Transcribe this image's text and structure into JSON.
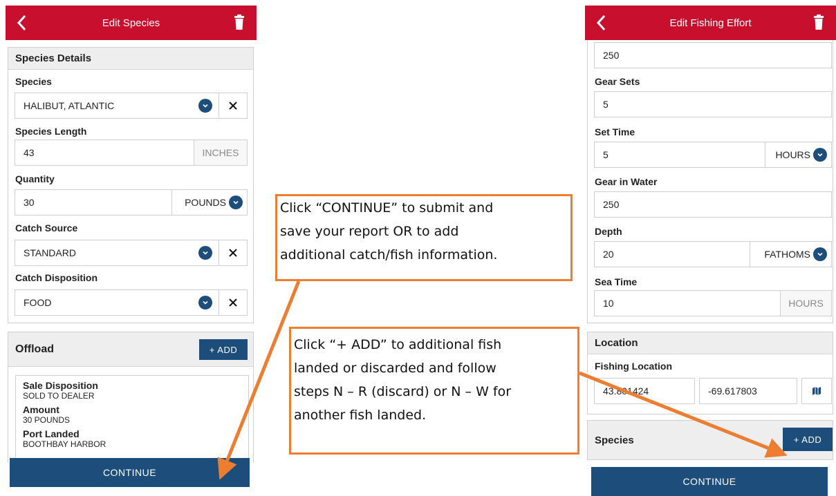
{
  "left": {
    "title": "Edit Species",
    "species_details_header": "Species Details",
    "species_label": "Species",
    "species_value": "HALIBUT, ATLANTIC",
    "length_label": "Species Length",
    "length_value": "43",
    "length_unit": "INCHES",
    "quantity_label": "Quantity",
    "quantity_value": "30",
    "quantity_unit": "POUNDS",
    "catch_source_label": "Catch Source",
    "catch_source_value": "STANDARD",
    "catch_disposition_label": "Catch Disposition",
    "catch_disposition_value": "FOOD",
    "offload_header": "Offload",
    "add_label": "+ ADD",
    "offload": [
      {
        "key": "Sale Disposition",
        "value": "SOLD TO DEALER"
      },
      {
        "key": "Amount",
        "value": "30 POUNDS"
      },
      {
        "key": "Port Landed",
        "value": "BOOTHBAY HARBOR"
      }
    ],
    "continue_label": "CONTINUE"
  },
  "right": {
    "title": "Edit Fishing Effort",
    "top_value": "250",
    "gear_sets_label": "Gear Sets",
    "gear_sets_value": "5",
    "set_time_label": "Set Time",
    "set_time_value": "5",
    "set_time_unit": "HOURS",
    "gear_in_water_label": "Gear in Water",
    "gear_in_water_value": "250",
    "depth_label": "Depth",
    "depth_value": "20",
    "depth_unit": "FATHOMS",
    "sea_time_label": "Sea Time",
    "sea_time_value": "10",
    "sea_time_unit": "HOURS",
    "location_header": "Location",
    "fishing_location_label": "Fishing Location",
    "latitude": "43.801424",
    "longitude": "-69.617803",
    "species_header": "Species",
    "add_label": "+ ADD",
    "continue_label": "CONTINUE"
  },
  "callouts": {
    "continue_lines": [
      "Click “CONTINUE” to submit and",
      "save your report OR to add",
      "additional catch/fish information."
    ],
    "add_lines": [
      "Click “+ ADD” to additional fish",
      "landed or discarded and follow",
      "steps N – R (discard) or N – W for",
      "another fish landed."
    ]
  },
  "colors": {
    "header_red": "#c8102e",
    "primary_blue": "#1d4d7a",
    "callout_orange": "#ed7d31"
  },
  "icons": [
    "back-chevron-icon",
    "trash-icon",
    "chevron-down-icon",
    "close-icon",
    "map-icon"
  ]
}
